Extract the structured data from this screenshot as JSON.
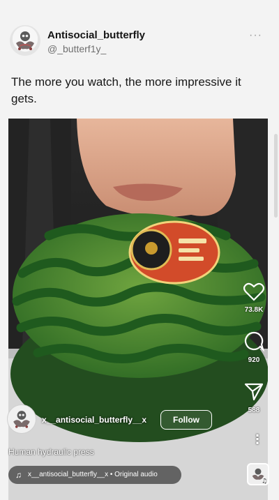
{
  "post": {
    "display_name": "Antisocial_butterfly",
    "handle": "@_butterf1y_",
    "more_icon": "ellipsis-icon",
    "text": "The more you watch, the more impressive it gets."
  },
  "reel": {
    "username": "x__antisocial_butterfly__x",
    "follow_label": "Follow",
    "caption": "Human hydraulic press",
    "audio": {
      "icon": "music-note-icon",
      "text": "x__antisocial_butterfly__x • Original audio"
    },
    "actions": [
      {
        "icon": "heart-icon",
        "count": "73.8K"
      },
      {
        "icon": "comment-icon",
        "count": "920"
      },
      {
        "icon": "share-icon",
        "count": "588"
      }
    ],
    "more_icon": "vertical-ellipsis-icon"
  },
  "colors": {
    "page_bg": "#f3f3f3",
    "video_bg": "#1b1b1b",
    "watermelon_dark": "#1f5a1e",
    "watermelon_light": "#7fb04a",
    "label_red": "#d24b2a"
  }
}
